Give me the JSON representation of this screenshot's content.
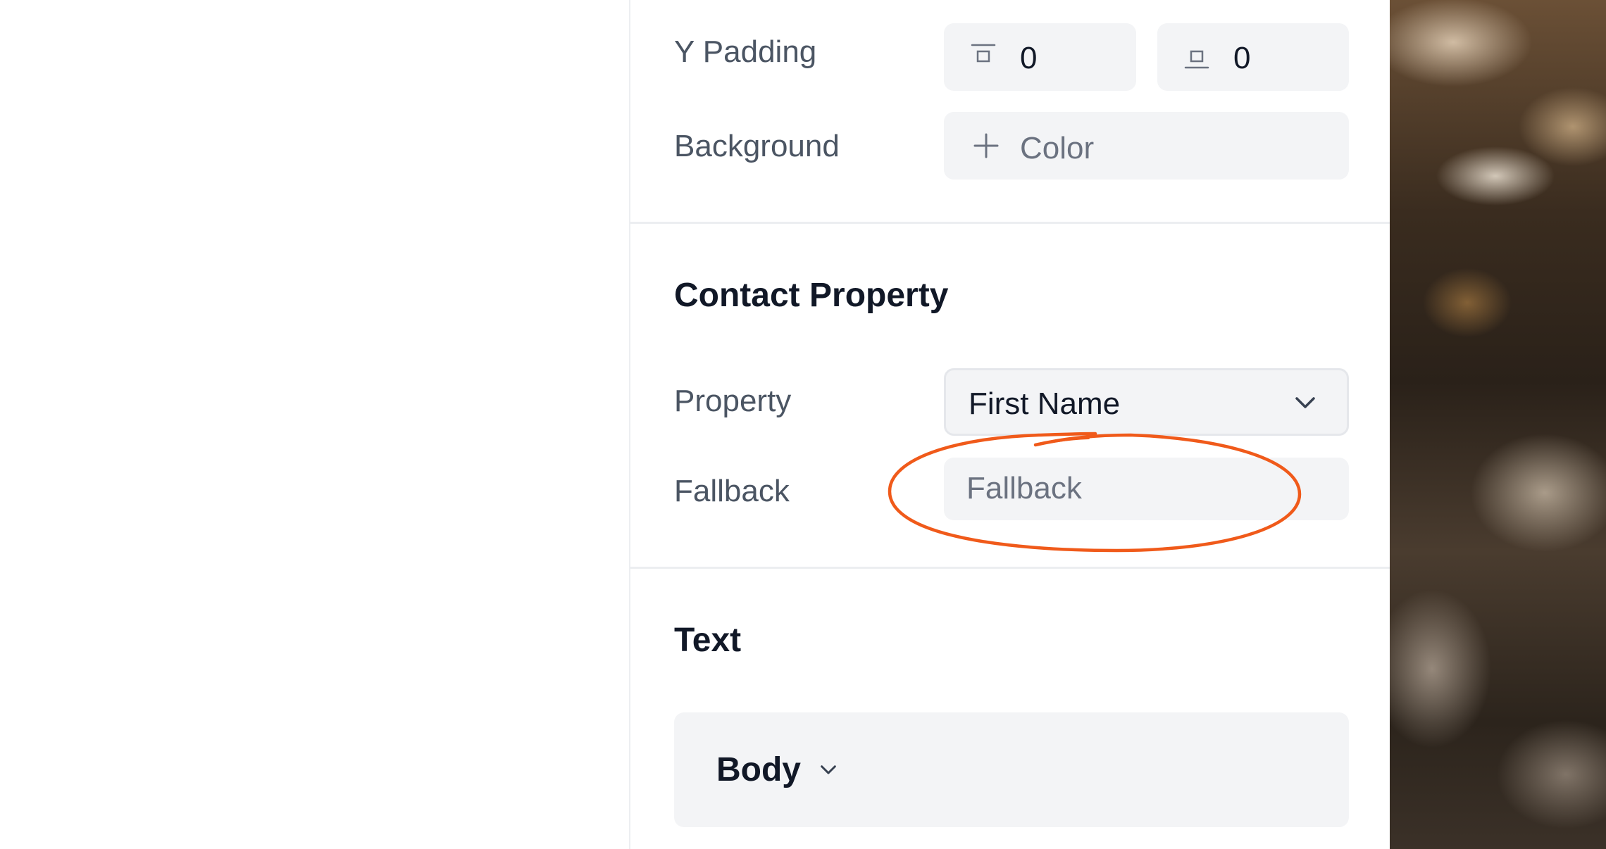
{
  "layout_section": {
    "y_padding_label": "Y Padding",
    "y_padding_top_value": "0",
    "y_padding_bottom_value": "0",
    "background_label": "Background",
    "background_add_label": "Color"
  },
  "contact_property": {
    "heading": "Contact Property",
    "property_label": "Property",
    "property_selected": "First Name",
    "fallback_label": "Fallback",
    "fallback_placeholder": "Fallback"
  },
  "text_section": {
    "heading": "Text",
    "style_selected": "Body"
  },
  "colors": {
    "annotation": "#f05a1a",
    "field_background": "#f3f4f6",
    "heading_text": "#111827",
    "label_text": "#4b5563"
  },
  "icons": {
    "padding_top": "padding-top-icon",
    "padding_bottom": "padding-bottom-icon",
    "add": "plus-icon",
    "property_dropdown": "chevron-down-icon",
    "style_dropdown": "chevron-down-icon"
  }
}
